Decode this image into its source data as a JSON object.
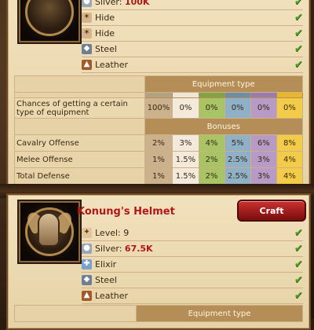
{
  "top_item": {
    "requirements": [
      {
        "icon": "silver-icon",
        "label": "Silver:",
        "value": "100K",
        "met": true
      },
      {
        "icon": "hide-icon",
        "label": "Hide",
        "met": true
      },
      {
        "icon": "hide-icon",
        "label": "Hide",
        "met": true
      },
      {
        "icon": "steel-icon",
        "label": "Steel",
        "met": true
      },
      {
        "icon": "leather-icon",
        "label": "Leather",
        "met": true
      }
    ],
    "table": {
      "equipment_type_header": "Equipment type",
      "chances_label": "Chances of getting a certain type of equipment",
      "chances": [
        "100%",
        "0%",
        "0%",
        "0%",
        "0%",
        "0%"
      ],
      "bonuses_header": "Bonuses",
      "rows": [
        {
          "label": "Cavalry Offense",
          "values": [
            "2%",
            "3%",
            "4%",
            "5%",
            "6%",
            "8%"
          ]
        },
        {
          "label": "Melee Offense",
          "values": [
            "1%",
            "1.5%",
            "2%",
            "2.5%",
            "3%",
            "4%"
          ]
        },
        {
          "label": "Total Defense",
          "values": [
            "1%",
            "1.5%",
            "2%",
            "2.5%",
            "3%",
            "4%"
          ]
        }
      ]
    }
  },
  "bottom_item": {
    "name": "Konung's Helmet",
    "craft_label": "Craft",
    "requirements": [
      {
        "icon": "level-icon",
        "label": "Level: 9",
        "met": true
      },
      {
        "icon": "silver-icon",
        "label": "Silver:",
        "value": "67.5K",
        "met": true
      },
      {
        "icon": "elixir-icon",
        "label": "Elixir",
        "met": true
      },
      {
        "icon": "steel-icon",
        "label": "Steel",
        "met": true
      },
      {
        "icon": "leather-icon",
        "label": "Leather",
        "met": true
      }
    ],
    "equipment_type_header": "Equipment type"
  },
  "colors": {
    "accent_red": "#b01818",
    "check_green": "#49a11b",
    "tier_colors": [
      "#cbb28d",
      "#f3eadb",
      "#a8c464",
      "#8fb1c7",
      "#b79ac5",
      "#f2cc49"
    ]
  }
}
